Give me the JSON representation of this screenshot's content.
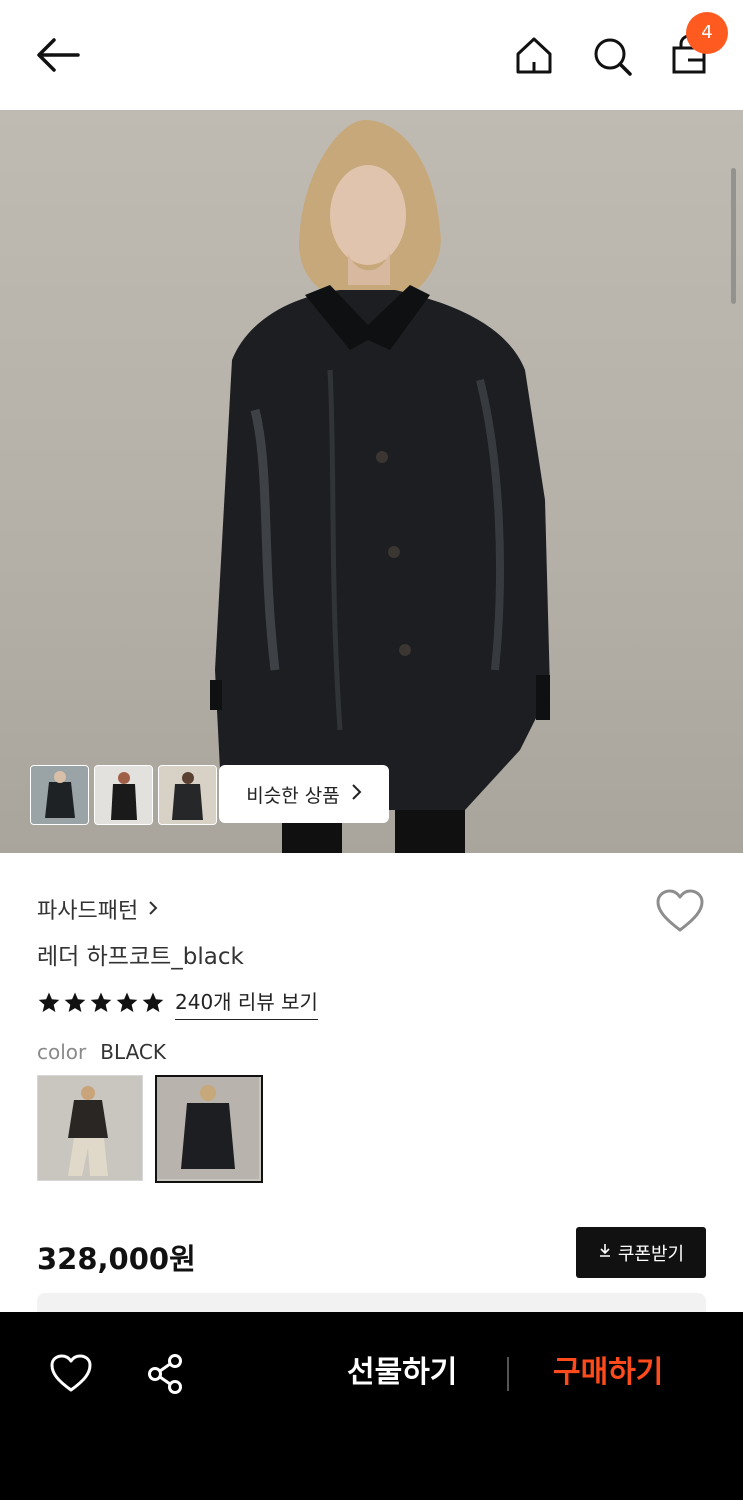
{
  "header": {
    "cart_count": "4"
  },
  "gallery": {
    "similar_button_label": "비슷한 상품"
  },
  "product": {
    "brand": "파사드패턴",
    "name": "레더 하프코트_black",
    "rating_stars": 5,
    "review_link": "240개 리뷰 보기",
    "color_label": "color",
    "color_value": "BLACK",
    "price": "328,000원",
    "coupon_button": "쿠폰받기"
  },
  "bottom_bar": {
    "gift_label": "선물하기",
    "buy_label": "구매하기"
  },
  "colors": {
    "accent": "#ff5a1f",
    "buy": "#ff4a1c",
    "bar": "#000000"
  }
}
